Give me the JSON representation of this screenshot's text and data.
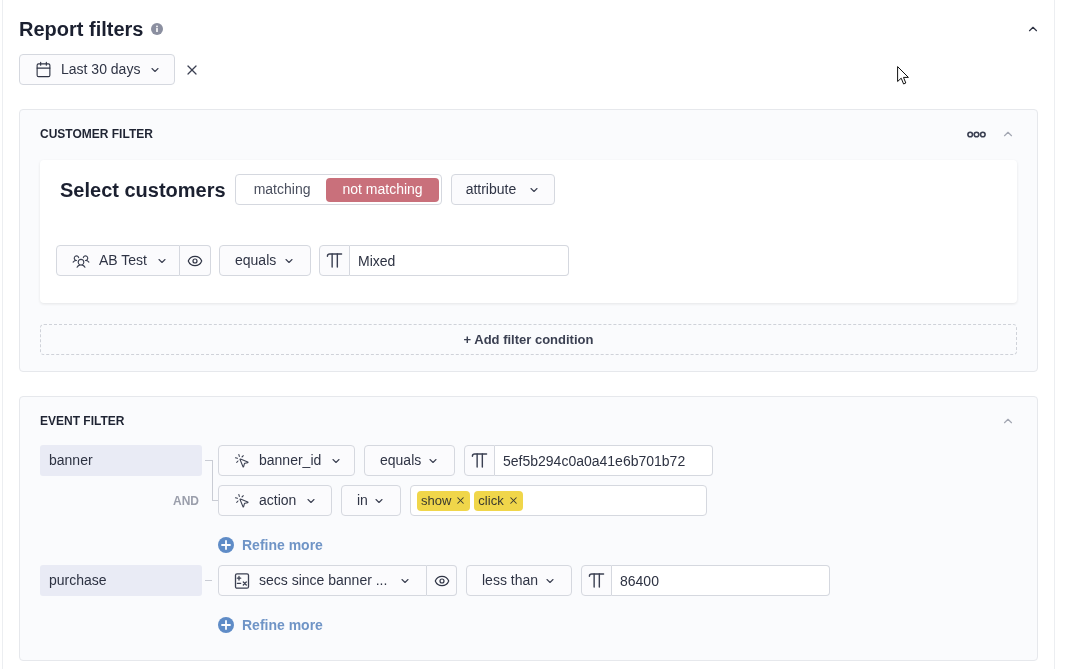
{
  "header": {
    "title": "Report filters",
    "expanded": true
  },
  "date_range": {
    "label": "Last 30 days"
  },
  "customer_filter": {
    "title": "CUSTOMER FILTER",
    "expanded": true,
    "heading": "Select customers",
    "match_modes": [
      {
        "label": "matching",
        "selected": false
      },
      {
        "label": "not matching",
        "selected": true
      }
    ],
    "criterion": "attribute",
    "conditions": [
      {
        "attribute": "AB Test",
        "operator": "equals",
        "value": "Mixed"
      }
    ],
    "add_label": "+ Add filter condition"
  },
  "event_filter": {
    "title": "EVENT FILTER",
    "expanded": true,
    "events": [
      {
        "name": "banner",
        "conditions": [
          {
            "kind": "text",
            "property": {
              "kind": "event",
              "label": "banner_id"
            },
            "operator": "equals",
            "value": "5ef5b294c0a0a41e6b701b72"
          },
          {
            "kind": "tags",
            "joiner": "AND",
            "property": {
              "kind": "event",
              "label": "action"
            },
            "operator": "in",
            "tags": [
              "show",
              "click"
            ]
          }
        ],
        "refine_label": "Refine more"
      },
      {
        "name": "purchase",
        "conditions": [
          {
            "kind": "text",
            "property": {
              "kind": "computed",
              "label": "secs since banner ..."
            },
            "operator": "less than",
            "value": "86400"
          }
        ],
        "refine_label": "Refine more"
      }
    ]
  }
}
